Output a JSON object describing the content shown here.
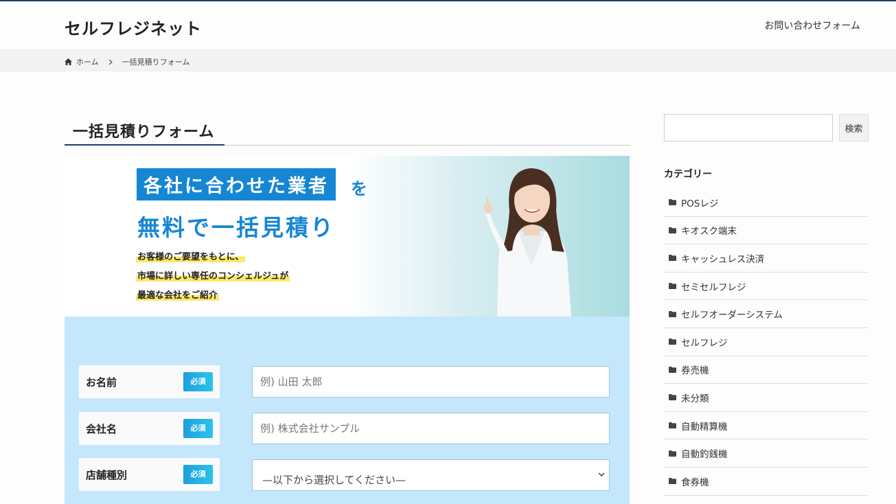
{
  "header": {
    "site_title": "セルフレジネット",
    "nav_link": "お問い合わせフォーム"
  },
  "breadcrumb": {
    "home_icon": "home-icon",
    "home": "ホーム",
    "separator_icon": "chevron-right-icon",
    "current": "一括見積りフォーム"
  },
  "main": {
    "page_title": "一括見積りフォーム"
  },
  "hero": {
    "headline": "各社に合わせた業者",
    "headline_suffix": "を",
    "title_line2": "無料で一括見積り",
    "sub_lines": [
      "お客様のご要望をもとに、",
      "市場に詳しい専任のコンシェルジュが",
      "最適な会社をご紹介"
    ]
  },
  "form": {
    "required_label": "必須",
    "fields": [
      {
        "label": "お名前",
        "placeholder": "例) 山田 太郎"
      },
      {
        "label": "会社名",
        "placeholder": "例) 株式会社サンプル"
      },
      {
        "label": "店舗種別",
        "selected": "—以下から選択してください—"
      }
    ]
  },
  "sidebar": {
    "search_placeholder": "",
    "search_button": "検索",
    "category_heading": "カテゴリー",
    "categories": [
      "POSレジ",
      "キオスク端末",
      "キャッシュレス決済",
      "セミセルフレジ",
      "セルフオーダーシステム",
      "セルフレジ",
      "券売機",
      "未分類",
      "自動精算機",
      "自動釣銭機",
      "食券機"
    ]
  },
  "colors": {
    "brand_navy": "#1f3b66",
    "accent_blue": "#1586d4",
    "form_bg": "#c4e7fb",
    "badge_gradient_start": "#1e9fe0",
    "badge_gradient_end": "#2bc3e8",
    "highlight_yellow": "#ffe86b"
  }
}
